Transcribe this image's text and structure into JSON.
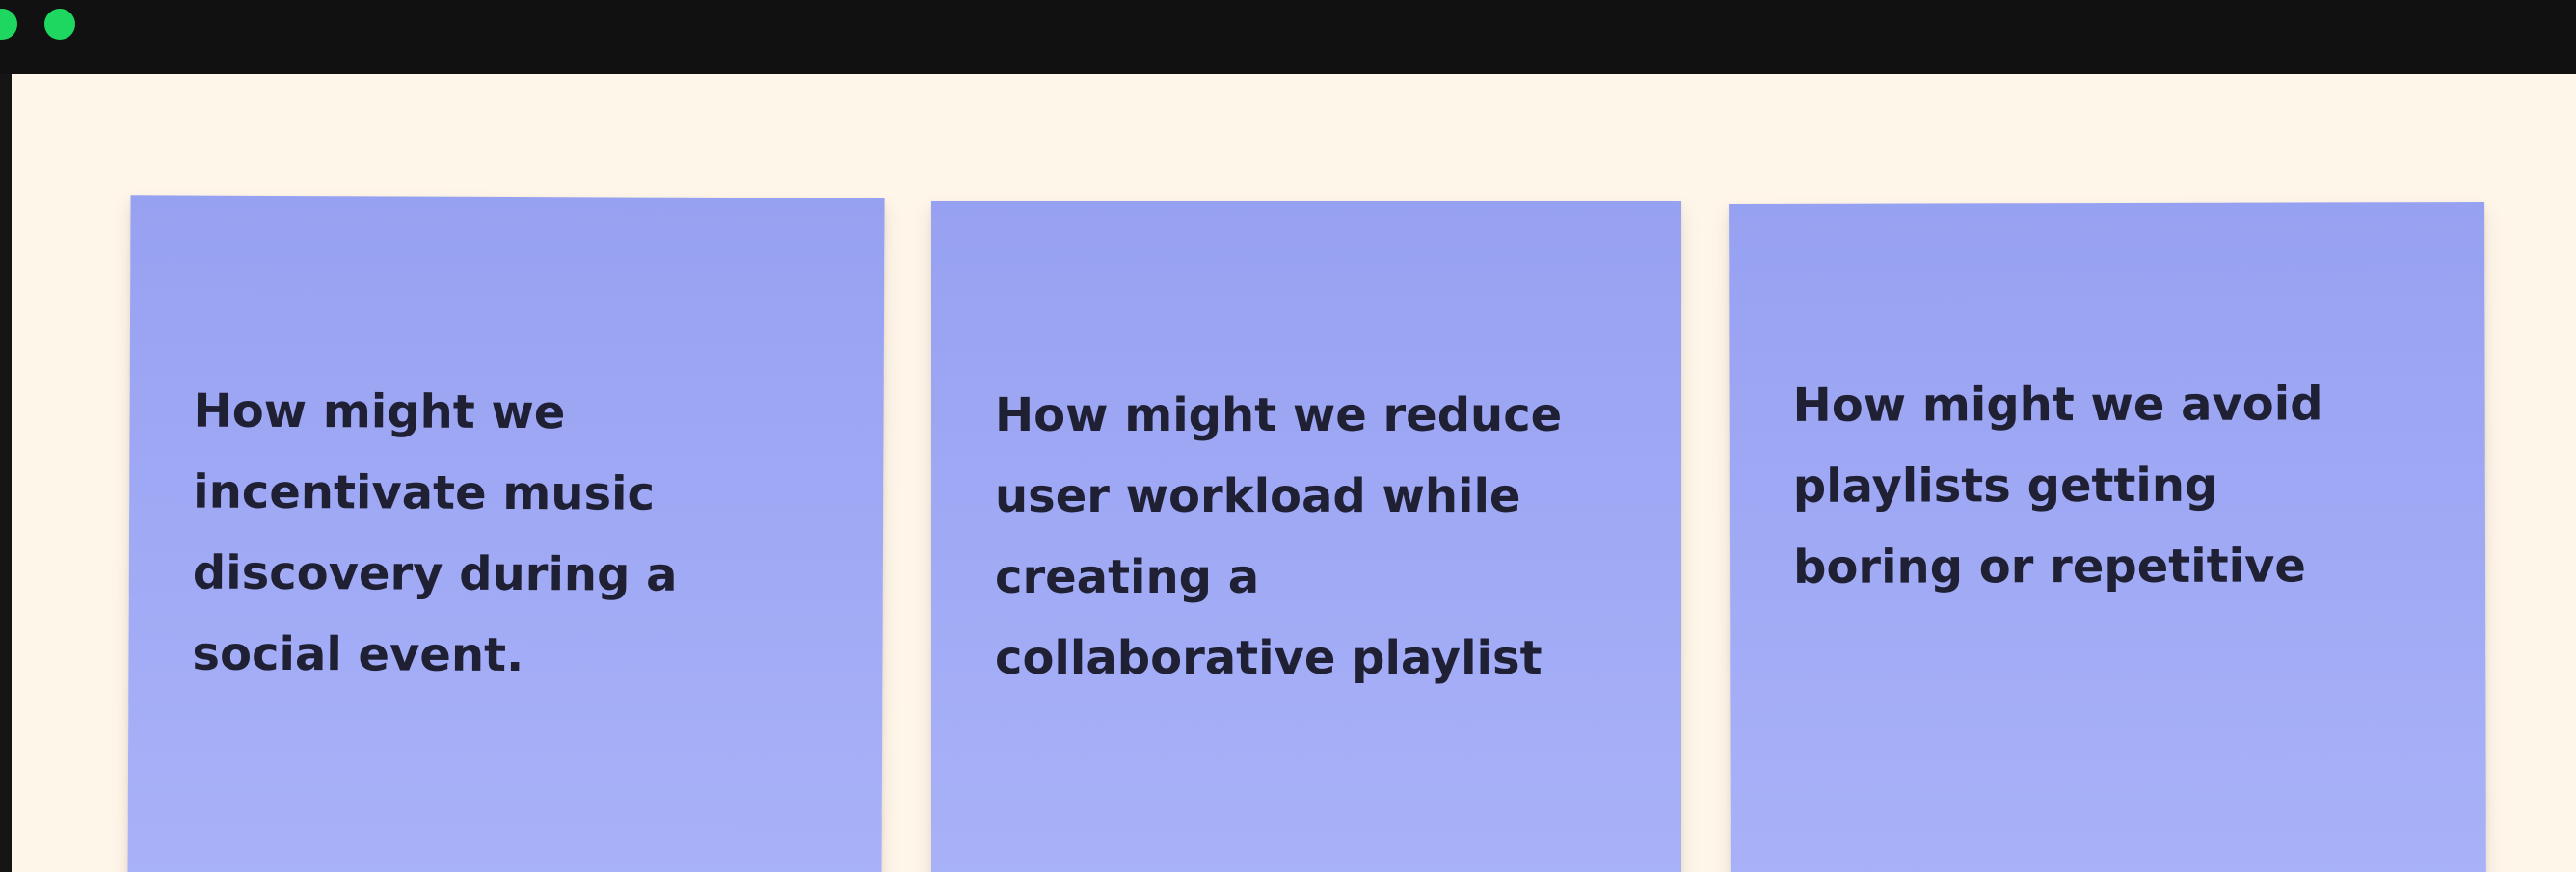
{
  "colors": {
    "window_chrome": "#111111",
    "canvas_background": "#fff6ea",
    "sticky_note_top": "#97a1f1",
    "sticky_note_bottom": "#a9b2f8",
    "note_text": "#1f2033",
    "window_dot": "#1ed760"
  },
  "notes": [
    {
      "text": "How might we\nincentivate music\ndiscovery during a\nsocial event."
    },
    {
      "text": "How might we reduce\nuser workload while\ncreating a\ncollaborative playlist"
    },
    {
      "text": "How might we avoid\nplaylists getting\nboring or repetitive"
    }
  ]
}
